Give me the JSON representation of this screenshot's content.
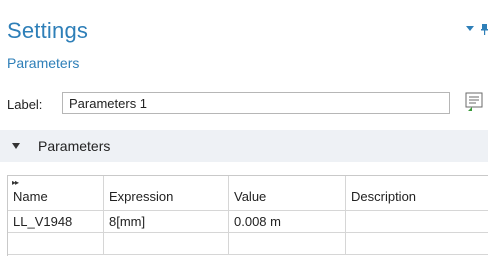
{
  "settings": {
    "title": "Settings",
    "subtitle": "Parameters",
    "accent_color": "#2e7fb8"
  },
  "label_field": {
    "label": "Label:",
    "value": "Parameters 1"
  },
  "section": {
    "title": "Parameters"
  },
  "table": {
    "sort_glyph": "▸▸",
    "columns": [
      "Name",
      "Expression",
      "Value",
      "Description"
    ],
    "rows": [
      [
        "LL_V1948",
        "8[mm]",
        "0.008 m",
        ""
      ],
      [
        "",
        "",
        "",
        ""
      ]
    ]
  },
  "icons": {
    "header_menu": "chevron-down-icon",
    "header_pin": "pin-icon",
    "label_button": "text-edit-icon",
    "section_toggle": "triangle-down-icon"
  }
}
